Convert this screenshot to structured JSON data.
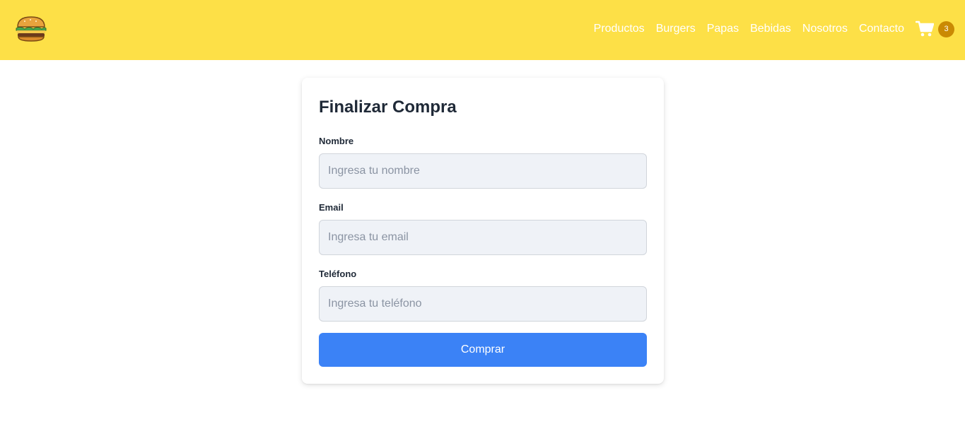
{
  "brand": {
    "logo_icon": "burger-icon"
  },
  "nav": {
    "links": [
      "Productos",
      "Burgers",
      "Papas",
      "Bebidas",
      "Nosotros",
      "Contacto"
    ],
    "cart_icon": "cart-icon",
    "cart_count": "3"
  },
  "checkout": {
    "title": "Finalizar Compra",
    "fields": [
      {
        "label": "Nombre",
        "placeholder": "Ingresa tu nombre",
        "value": ""
      },
      {
        "label": "Email",
        "placeholder": "Ingresa tu email",
        "value": ""
      },
      {
        "label": "Teléfono",
        "placeholder": "Ingresa tu teléfono",
        "value": ""
      }
    ],
    "submit_label": "Comprar"
  },
  "colors": {
    "header": "#fde047",
    "badge": "#ca8a04",
    "button": "#3b82f6",
    "input_bg": "#eff2f7"
  }
}
